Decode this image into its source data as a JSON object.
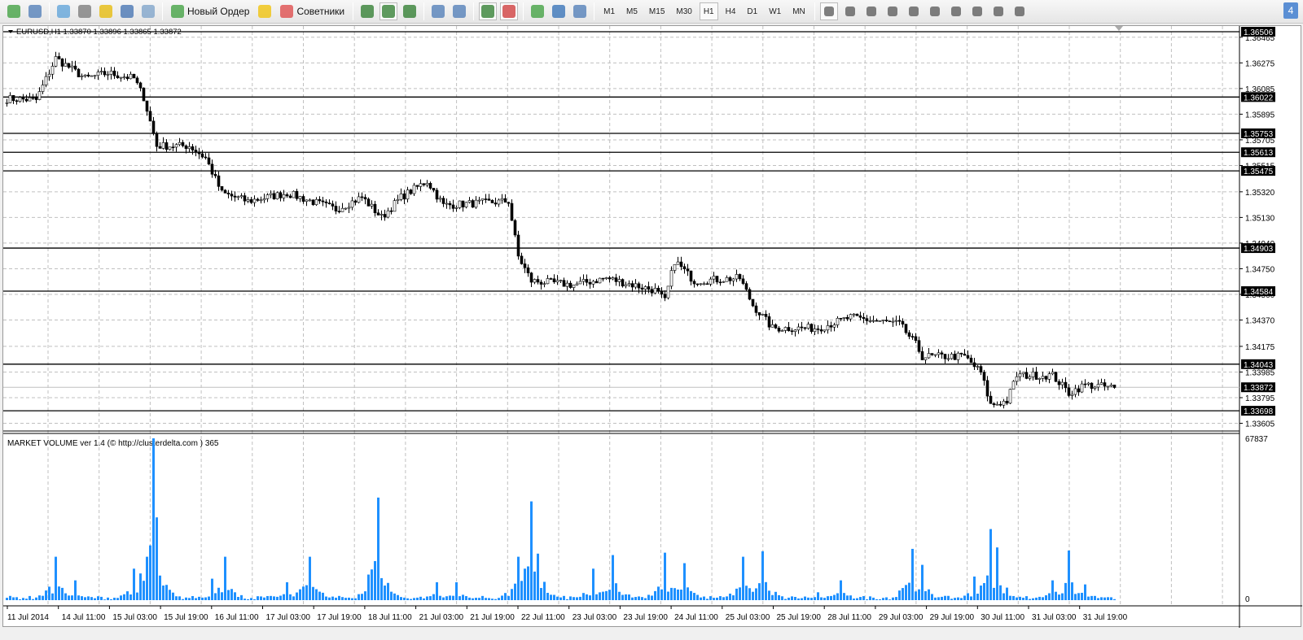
{
  "toolbar": {
    "new_order": "Новый Ордер",
    "experts": "Советники",
    "timeframes": [
      "M1",
      "M5",
      "M15",
      "M30",
      "H1",
      "H4",
      "D1",
      "W1",
      "MN"
    ],
    "active_timeframe": "H1",
    "notification_count": "4",
    "icons": [
      "new-chart-icon",
      "profiles-icon",
      "market-watch-icon",
      "navigator-crosshair-icon",
      "favorites-icon",
      "terminal-icon",
      "strategy-tester-icon",
      "new-order-icon",
      "experts-warning-icon",
      "bar-chart-icon",
      "candlestick-icon",
      "line-chart-icon",
      "zoom-in-icon",
      "zoom-out-icon",
      "autoscroll-icon",
      "chart-shift-icon",
      "indicators-icon",
      "periods-icon",
      "templates-icon",
      "cursor-icon",
      "crosshair-icon",
      "vertical-line-icon",
      "horizontal-line-icon",
      "trendline-icon",
      "equidistant-channel-icon",
      "fibonacci-icon",
      "text-icon",
      "text-label-icon",
      "arrows-icon"
    ]
  },
  "chart": {
    "title": "EURUSD,H1  1.33870 1.33896 1.33865 1.33872",
    "symbol": "EURUSD",
    "period": "H1",
    "ohlc": {
      "open": 1.3387,
      "high": 1.33896,
      "low": 1.33865,
      "close": 1.33872
    },
    "price_range": [
      1.3356,
      1.3653
    ],
    "price_ticks": [
      "1.36465",
      "1.36275",
      "1.36085",
      "1.35895",
      "1.35705",
      "1.35515",
      "1.35320",
      "1.35130",
      "1.34940",
      "1.34750",
      "1.34560",
      "1.34370",
      "1.34175",
      "1.33985",
      "1.33795",
      "1.33605"
    ],
    "hlines": [
      "1.36506",
      "1.36022",
      "1.35753",
      "1.35613",
      "1.35475",
      "1.34903",
      "1.34584",
      "1.34043",
      "1.33698"
    ],
    "bid_line": "1.33872",
    "path": [
      [
        0,
        1.3601
      ],
      [
        9,
        1.36
      ],
      [
        15,
        1.3631
      ],
      [
        24,
        1.3616
      ],
      [
        31,
        1.362
      ],
      [
        39,
        1.3616
      ],
      [
        42,
        1.3602
      ],
      [
        46,
        1.3566
      ],
      [
        56,
        1.3566
      ],
      [
        61,
        1.3557
      ],
      [
        66,
        1.3531
      ],
      [
        74,
        1.3525
      ],
      [
        86,
        1.3531
      ],
      [
        101,
        1.3519
      ],
      [
        109,
        1.3528
      ],
      [
        115,
        1.3513
      ],
      [
        121,
        1.3528
      ],
      [
        129,
        1.354
      ],
      [
        134,
        1.3522
      ],
      [
        154,
        1.3525
      ],
      [
        157,
        1.3484
      ],
      [
        161,
        1.3466
      ],
      [
        174,
        1.3463
      ],
      [
        184,
        1.3468
      ],
      [
        199,
        1.3459
      ],
      [
        202,
        1.3451
      ],
      [
        205,
        1.3481
      ],
      [
        211,
        1.3466
      ],
      [
        225,
        1.3468
      ],
      [
        229,
        1.3448
      ],
      [
        235,
        1.3431
      ],
      [
        249,
        1.3431
      ],
      [
        259,
        1.3439
      ],
      [
        274,
        1.3434
      ],
      [
        279,
        1.3419
      ],
      [
        281,
        1.341
      ],
      [
        294,
        1.341
      ],
      [
        299,
        1.3398
      ],
      [
        302,
        1.3374
      ],
      [
        307,
        1.3377
      ],
      [
        310,
        1.3396
      ],
      [
        321,
        1.3396
      ],
      [
        326,
        1.3383
      ],
      [
        331,
        1.3389
      ],
      [
        340,
        1.3387
      ]
    ]
  },
  "volume": {
    "title": "MARKET VOLUME ver 1.4 (© http://clusterdelta.com ) 365",
    "max_label": "67837",
    "min_label": "0",
    "max": 67837,
    "peaks": [
      [
        15,
        18200
      ],
      [
        21,
        8300
      ],
      [
        39,
        13200
      ],
      [
        43,
        18200
      ],
      [
        45,
        67837
      ],
      [
        46,
        34700
      ],
      [
        63,
        9000
      ],
      [
        67,
        18200
      ],
      [
        86,
        7500
      ],
      [
        93,
        18200
      ],
      [
        113,
        12000
      ],
      [
        114,
        43000
      ],
      [
        132,
        7500
      ],
      [
        138,
        7500
      ],
      [
        157,
        18200
      ],
      [
        161,
        41400
      ],
      [
        163,
        19500
      ],
      [
        180,
        13200
      ],
      [
        186,
        18900
      ],
      [
        202,
        19900
      ],
      [
        208,
        15500
      ],
      [
        226,
        18200
      ],
      [
        232,
        20500
      ],
      [
        249,
        3300
      ],
      [
        256,
        8300
      ],
      [
        278,
        21500
      ],
      [
        281,
        14800
      ],
      [
        297,
        9900
      ],
      [
        302,
        29800
      ],
      [
        304,
        22100
      ],
      [
        321,
        8300
      ],
      [
        326,
        20800
      ],
      [
        331,
        6600
      ]
    ]
  },
  "xaxis": {
    "labels": [
      "11 Jul 2014",
      "14 Jul 11:00",
      "15 Jul 03:00",
      "15 Jul 19:00",
      "16 Jul 11:00",
      "17 Jul 03:00",
      "17 Jul 19:00",
      "18 Jul 11:00",
      "21 Jul 03:00",
      "21 Jul 19:00",
      "22 Jul 11:00",
      "23 Jul 03:00",
      "23 Jul 19:00",
      "24 Jul 11:00",
      "25 Jul 03:00",
      "25 Jul 19:00",
      "28 Jul 11:00",
      "29 Jul 03:00",
      "29 Jul 19:00",
      "30 Jul 11:00",
      "31 Jul 03:00",
      "31 Jul 19:00"
    ]
  },
  "colors": {
    "volume": "#1e90ff",
    "label_bg": "#000000",
    "grid": "#c0c0c0"
  }
}
